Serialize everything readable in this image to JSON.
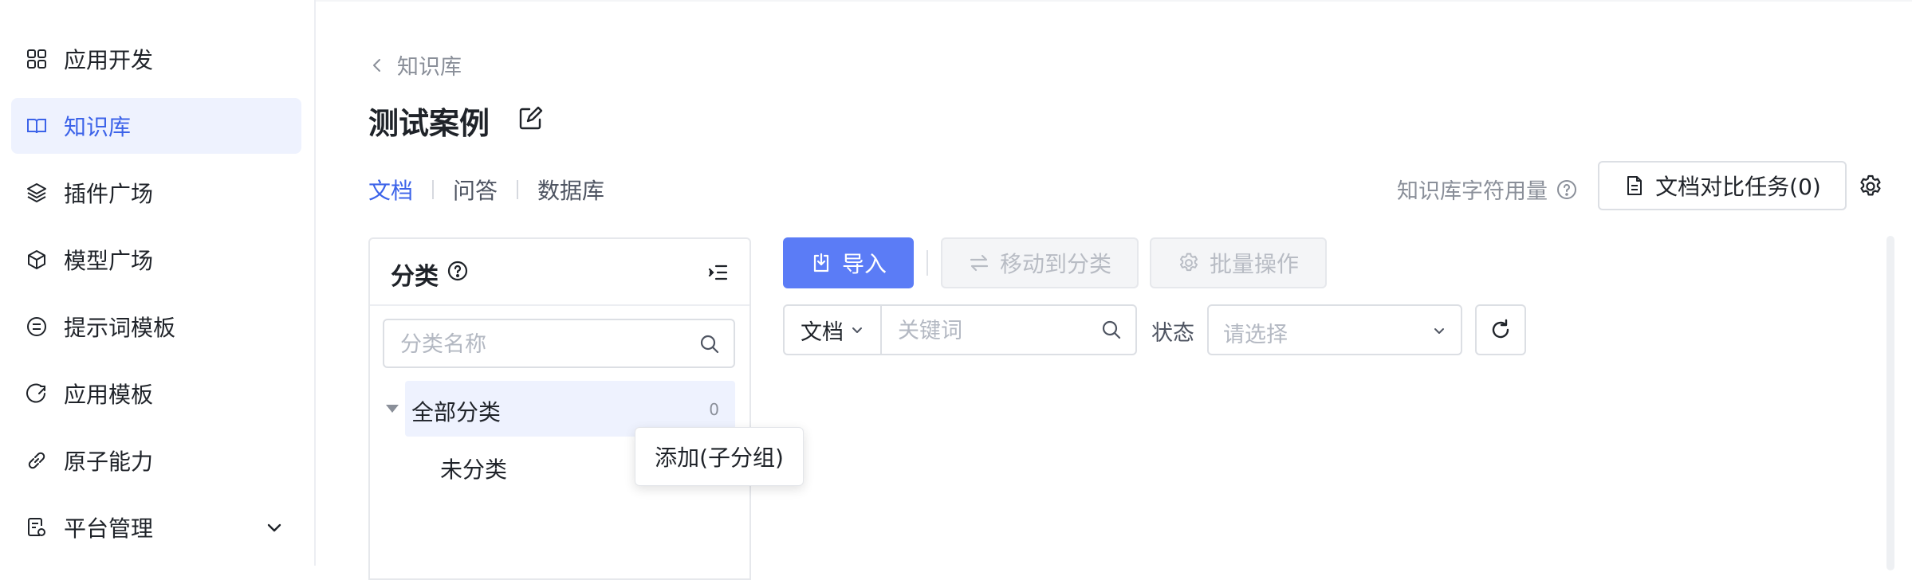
{
  "sidebar": {
    "items": [
      {
        "label": "应用开发",
        "icon": "grid-icon"
      },
      {
        "label": "知识库",
        "icon": "book-icon",
        "active": true
      },
      {
        "label": "插件广场",
        "icon": "layers-icon"
      },
      {
        "label": "模型广场",
        "icon": "cube-icon"
      },
      {
        "label": "提示词模板",
        "icon": "chat-icon"
      },
      {
        "label": "应用模板",
        "icon": "app-template-icon"
      },
      {
        "label": "原子能力",
        "icon": "link-icon"
      },
      {
        "label": "平台管理",
        "icon": "settings-doc-icon",
        "expandable": true
      }
    ]
  },
  "breadcrumb": {
    "back_label": "知识库"
  },
  "page": {
    "title": "测试案例"
  },
  "tabs": [
    {
      "label": "文档",
      "active": true
    },
    {
      "label": "问答"
    },
    {
      "label": "数据库"
    }
  ],
  "toolbar_right": {
    "usage_label": "知识库字符用量",
    "compare_button": "文档对比任务(0)"
  },
  "category": {
    "title": "分类",
    "search_placeholder": "分类名称",
    "all_label": "全部分类",
    "all_count": "0",
    "uncategorized_label": "未分类",
    "tooltip": "添加(子分组)"
  },
  "actions": {
    "import": "导入",
    "move": "移动到分类",
    "batch": "批量操作"
  },
  "filters": {
    "type_value": "文档",
    "keyword_placeholder": "关键词",
    "status_label": "状态",
    "status_placeholder": "请选择"
  },
  "colors": {
    "accent": "#3c63e9",
    "primary_button": "#5b7cf6",
    "active_bg": "#eef2fe"
  }
}
